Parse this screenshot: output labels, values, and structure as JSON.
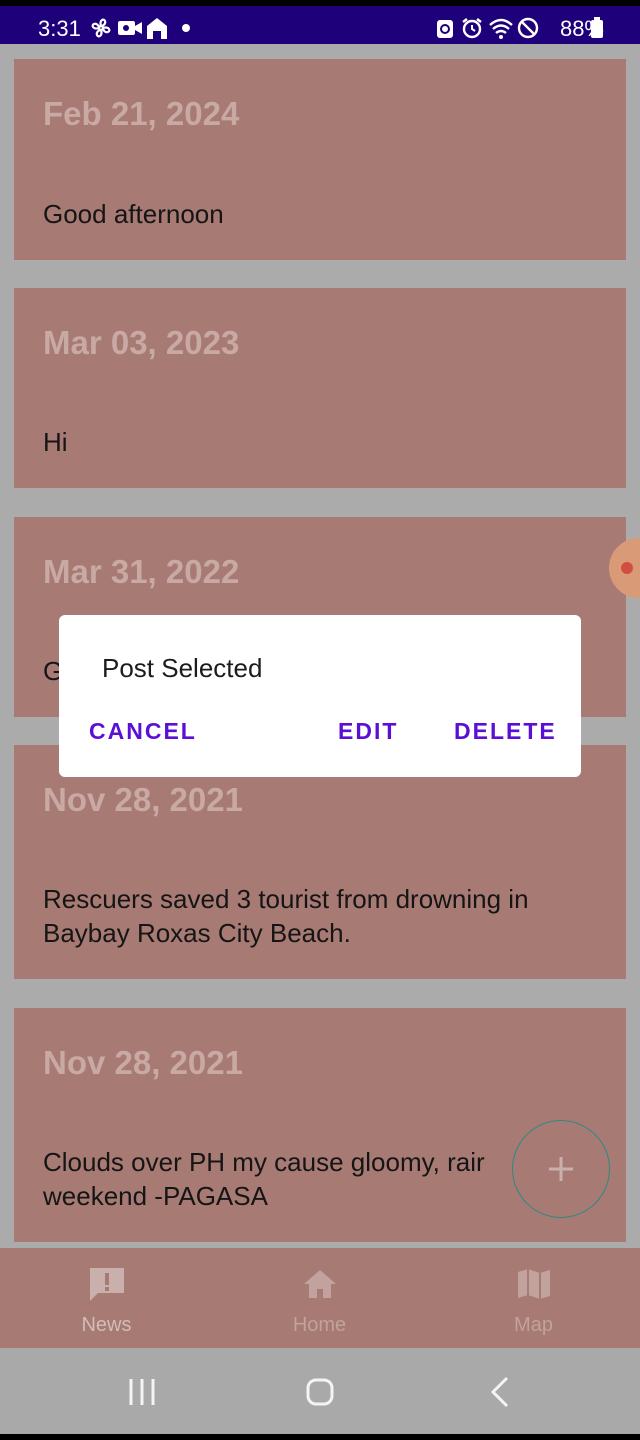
{
  "status_bar": {
    "time": "3:31",
    "battery": "88%",
    "bg_color": "#1e007a"
  },
  "posts": [
    {
      "date": "Feb 21, 2024",
      "text": "Good afternoon"
    },
    {
      "date": "Mar 03, 2023",
      "text": "Hi"
    },
    {
      "date": "Mar 31, 2022",
      "text": "G"
    },
    {
      "date": "Nov 28, 2021",
      "text": "Rescuers saved 3 tourist from drowning in Baybay Roxas City Beach."
    },
    {
      "date": "Nov 28, 2021",
      "text": "Clouds over PH my cause gloomy, rair weekend -PAGASA"
    }
  ],
  "dialog": {
    "title": "Post Selected",
    "cancel_label": "CANCEL",
    "edit_label": "EDIT",
    "delete_label": "DELETE",
    "accent_color": "#5b0fd6"
  },
  "fab": {
    "icon": "plus-icon"
  },
  "bottom_nav": {
    "items": [
      {
        "label": "News",
        "icon": "news-alert-icon",
        "active": true
      },
      {
        "label": "Home",
        "icon": "home-icon",
        "active": false
      },
      {
        "label": "Map",
        "icon": "map-icon",
        "active": false
      }
    ]
  },
  "colors": {
    "card": "#a87a74",
    "scrim": "#ababab"
  }
}
